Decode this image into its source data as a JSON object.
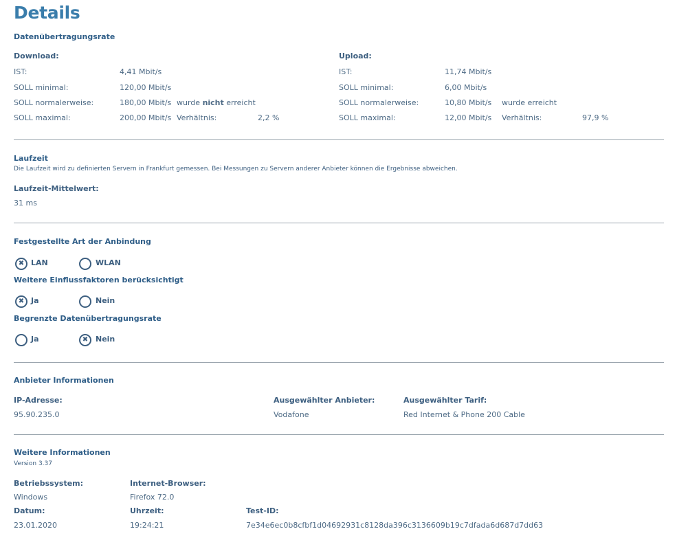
{
  "page_title": "Details",
  "rate": {
    "heading": "Datenübertragungsrate",
    "download": {
      "title": "Download:",
      "ist_label": "IST:",
      "ist": "4,41 Mbit/s",
      "min_label": "SOLL minimal:",
      "min": "120,00 Mbit/s",
      "norm_label": "SOLL normalerweise:",
      "norm": "180,00 Mbit/s",
      "norm_status_pre": "wurde",
      "norm_status_em": "nicht",
      "norm_status_post": "erreicht",
      "max_label": "SOLL maximal:",
      "max": "200,00 Mbit/s",
      "ratio_label": "Verhältnis:",
      "ratio": "2,2 %"
    },
    "upload": {
      "title": "Upload:",
      "ist_label": "IST:",
      "ist": "11,74 Mbit/s",
      "min_label": "SOLL minimal:",
      "min": "6,00 Mbit/s",
      "norm_label": "SOLL normalerweise:",
      "norm": "10,80 Mbit/s",
      "norm_status": "wurde erreicht",
      "max_label": "SOLL maximal:",
      "max": "12,00 Mbit/s",
      "ratio_label": "Verhältnis:",
      "ratio": "97,9 %"
    }
  },
  "latency": {
    "heading": "Laufzeit",
    "note": "Die Laufzeit wird zu definierten Servern in Frankfurt gemessen. Bei Messungen zu Servern anderer Anbieter können die Ergebnisse abweichen.",
    "mean_label": "Laufzeit-Mittelwert:",
    "mean_value": "31 ms"
  },
  "connection": {
    "heading": "Festgestellte Art der Anbindung",
    "options": [
      {
        "label": "LAN",
        "checked": true
      },
      {
        "label": "WLAN",
        "checked": false
      }
    ],
    "factors_heading": "Weitere Einflussfaktoren berücksichtigt",
    "factors_options": [
      {
        "label": "Ja",
        "checked": true
      },
      {
        "label": "Nein",
        "checked": false
      }
    ],
    "limited_heading": "Begrenzte Datenübertragungsrate",
    "limited_options": [
      {
        "label": "Ja",
        "checked": false
      },
      {
        "label": "Nein",
        "checked": true
      }
    ]
  },
  "provider": {
    "heading": "Anbieter Informationen",
    "ip_label": "IP-Adresse:",
    "ip": "95.90.235.0",
    "provider_label": "Ausgewählter Anbieter:",
    "provider": "Vodafone",
    "tariff_label": "Ausgewählter Tarif:",
    "tariff": "Red Internet & Phone 200 Cable"
  },
  "more": {
    "heading": "Weitere Informationen",
    "version": "Version 3.37",
    "os_label": "Betriebssystem:",
    "os": "Windows",
    "browser_label": "Internet-Browser:",
    "browser": "Firefox 72.0",
    "date_label": "Datum:",
    "date": "23.01.2020",
    "time_label": "Uhrzeit:",
    "time": "19:24:21",
    "testid_label": "Test-ID:",
    "testid": "7e34e6ec0b8cfbf1d04692931c8128da396c3136609b19c7dfada6d687d7dd63"
  },
  "colors": {
    "title": "#3a7dab",
    "heading": "#2e5d87",
    "text": "#3d5f80",
    "divider": "#9aa5ae"
  }
}
